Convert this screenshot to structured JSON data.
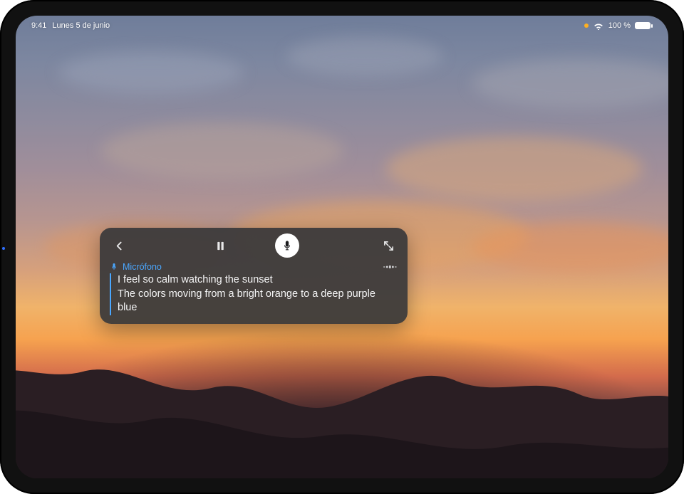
{
  "status": {
    "time": "9:41",
    "date": "Lunes 5 de junio",
    "battery": "100 %"
  },
  "panel": {
    "source_label": "Micrófono",
    "transcript_line1": "I feel so calm watching the sunset",
    "transcript_line2": "The colors moving from a bright orange to a deep purple blue"
  },
  "icons": {
    "back": "chevron-left-icon",
    "pause": "pause-icon",
    "mic": "microphone-icon",
    "expand": "expand-icon",
    "more": "more-icon",
    "wifi": "wifi-icon",
    "battery": "battery-icon",
    "location": "location-dot-icon"
  },
  "colors": {
    "panel_bg": "rgba(55,55,57,0.92)",
    "accent_blue": "#4aa7ff",
    "status_dot": "#ffb020"
  }
}
